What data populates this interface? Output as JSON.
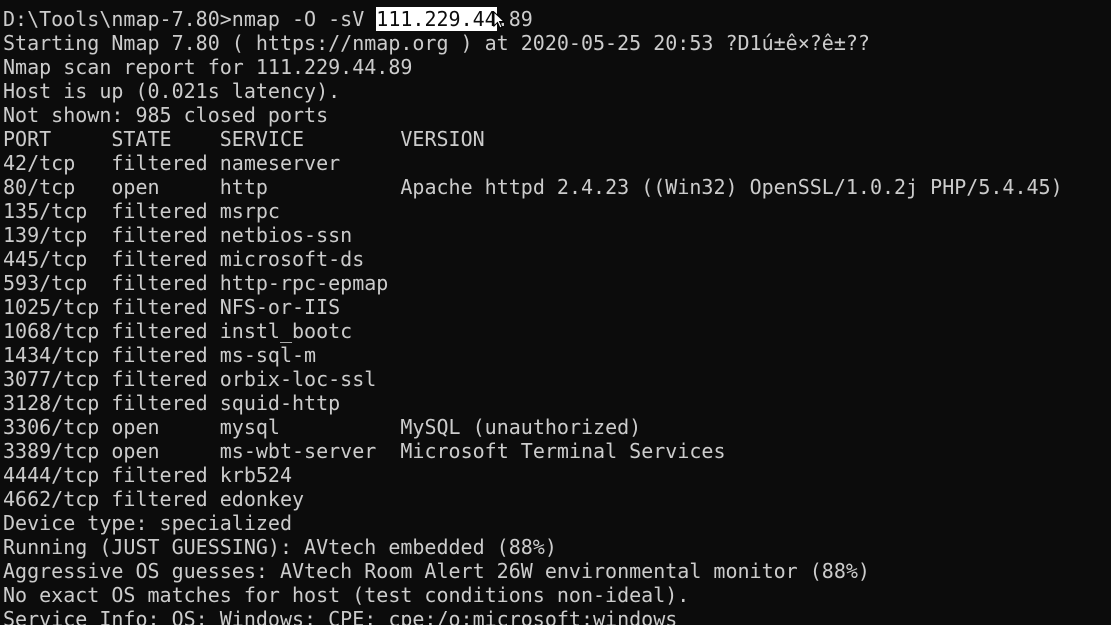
{
  "prompt": {
    "path": "D:\\Tools\\nmap-7.80>",
    "command_pre": "nmap -O -sV ",
    "command_selected": "111.229.44",
    "command_post": ".89"
  },
  "lines": {
    "starting": "Starting Nmap 7.80 ( https://nmap.org ) at 2020-05-25 20:53 ?D1ú±ê×?ê±??",
    "report": "Nmap scan report for 111.229.44.89",
    "host_up": "Host is up (0.021s latency).",
    "not_shown": "Not shown: 985 closed ports"
  },
  "table": {
    "headers": [
      "PORT",
      "STATE",
      "SERVICE",
      "VERSION"
    ],
    "rows": [
      {
        "port": "42/tcp",
        "state": "filtered",
        "service": "nameserver",
        "version": ""
      },
      {
        "port": "80/tcp",
        "state": "open",
        "service": "http",
        "version": "Apache httpd 2.4.23 ((Win32) OpenSSL/1.0.2j PHP/5.4.45)"
      },
      {
        "port": "135/tcp",
        "state": "filtered",
        "service": "msrpc",
        "version": ""
      },
      {
        "port": "139/tcp",
        "state": "filtered",
        "service": "netbios-ssn",
        "version": ""
      },
      {
        "port": "445/tcp",
        "state": "filtered",
        "service": "microsoft-ds",
        "version": ""
      },
      {
        "port": "593/tcp",
        "state": "filtered",
        "service": "http-rpc-epmap",
        "version": ""
      },
      {
        "port": "1025/tcp",
        "state": "filtered",
        "service": "NFS-or-IIS",
        "version": ""
      },
      {
        "port": "1068/tcp",
        "state": "filtered",
        "service": "instl_bootc",
        "version": ""
      },
      {
        "port": "1434/tcp",
        "state": "filtered",
        "service": "ms-sql-m",
        "version": ""
      },
      {
        "port": "3077/tcp",
        "state": "filtered",
        "service": "orbix-loc-ssl",
        "version": ""
      },
      {
        "port": "3128/tcp",
        "state": "filtered",
        "service": "squid-http",
        "version": ""
      },
      {
        "port": "3306/tcp",
        "state": "open",
        "service": "mysql",
        "version": "MySQL (unauthorized)"
      },
      {
        "port": "3389/tcp",
        "state": "open",
        "service": "ms-wbt-server",
        "version": "Microsoft Terminal Services"
      },
      {
        "port": "4444/tcp",
        "state": "filtered",
        "service": "krb524",
        "version": ""
      },
      {
        "port": "4662/tcp",
        "state": "filtered",
        "service": "edonkey",
        "version": ""
      }
    ]
  },
  "footer": {
    "device_type": "Device type: specialized",
    "running": "Running (JUST GUESSING): AVtech embedded (88%)",
    "os_guesses": "Aggressive OS guesses: AVtech Room Alert 26W environmental monitor (88%)",
    "no_exact": "No exact OS matches for host (test conditions non-ideal).",
    "service_info": "Service Info: OS: Windows; CPE: cpe:/o:microsoft:windows"
  },
  "colors": {
    "background": "#0c0c0c",
    "foreground": "#cccccc",
    "selection_bg": "#ffffff",
    "selection_fg": "#0c0c0c"
  },
  "icons": {
    "cursor": "mouse-pointer-icon"
  }
}
